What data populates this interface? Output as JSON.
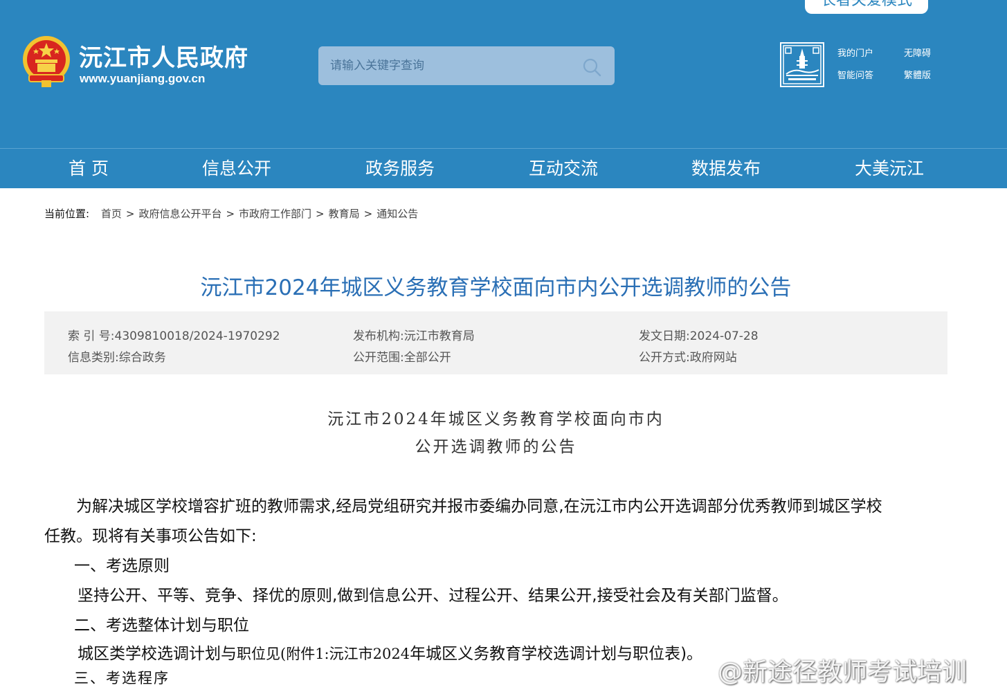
{
  "header": {
    "site_name": "沅江市人民政府",
    "site_url": "www.yuanjiang.gov.cn",
    "search_placeholder": "请输入关键字查询",
    "elder_mode": "长者关爱模式",
    "links": {
      "my_portal": "我的门户",
      "accessibility": "无障碍",
      "smart_qa": "智能问答",
      "traditional": "繁體版"
    }
  },
  "nav": [
    "首 页",
    "信息公开",
    "政务服务",
    "互动交流",
    "数据发布",
    "大美沅江"
  ],
  "breadcrumb": {
    "label": "当前位置:",
    "items": [
      "首页",
      "政府信息公开平台",
      "市政府工作部门",
      "教育局",
      "通知公告"
    ],
    "separator": ">"
  },
  "article": {
    "title": "沅江市2024年城区义务教育学校面向市内公开选调教师的公告",
    "meta": {
      "index_no": "索 引 号:4309810018/2024-1970292",
      "publisher": "发布机构:沅江市教育局",
      "date": "发文日期:2024-07-28",
      "category": "信息类别:综合政务",
      "scope": "公开范围:全部公开",
      "method": "公开方式:政府网站"
    },
    "doc_title_line1": "沅江市2024年城区义务教育学校面向市内",
    "doc_title_line2": "公开选调教师的公告",
    "intro_line1": "为解决城区学校增容扩班的教师需求,经局党组研究并报市委编办同意,在沅江市内公开选调部分优秀教师到城区学校",
    "intro_line2": "任教。现将有关事项公告如下:",
    "section1_heading": "一、考选原则",
    "section1_text": "坚持公开、平等、竞争、择优的原则,做到信息公开、过程公开、结果公开,接受社会及有关部门监督。",
    "section2_heading": "二、考选整体计划与职位",
    "section2_text_a": "城区类学校选调计划与",
    "section2_text_b": "职位见(附件1:沅江市2024",
    "section2_text_c": "年城区义务教育学校选调计划与职位表)。",
    "section3_heading": "三、考选程序"
  },
  "watermark": "@新途径教师考试培训",
  "colors": {
    "brand_blue": "#2b86bf",
    "title_blue": "#2a6fb5",
    "meta_bg": "#f2f2f2"
  }
}
